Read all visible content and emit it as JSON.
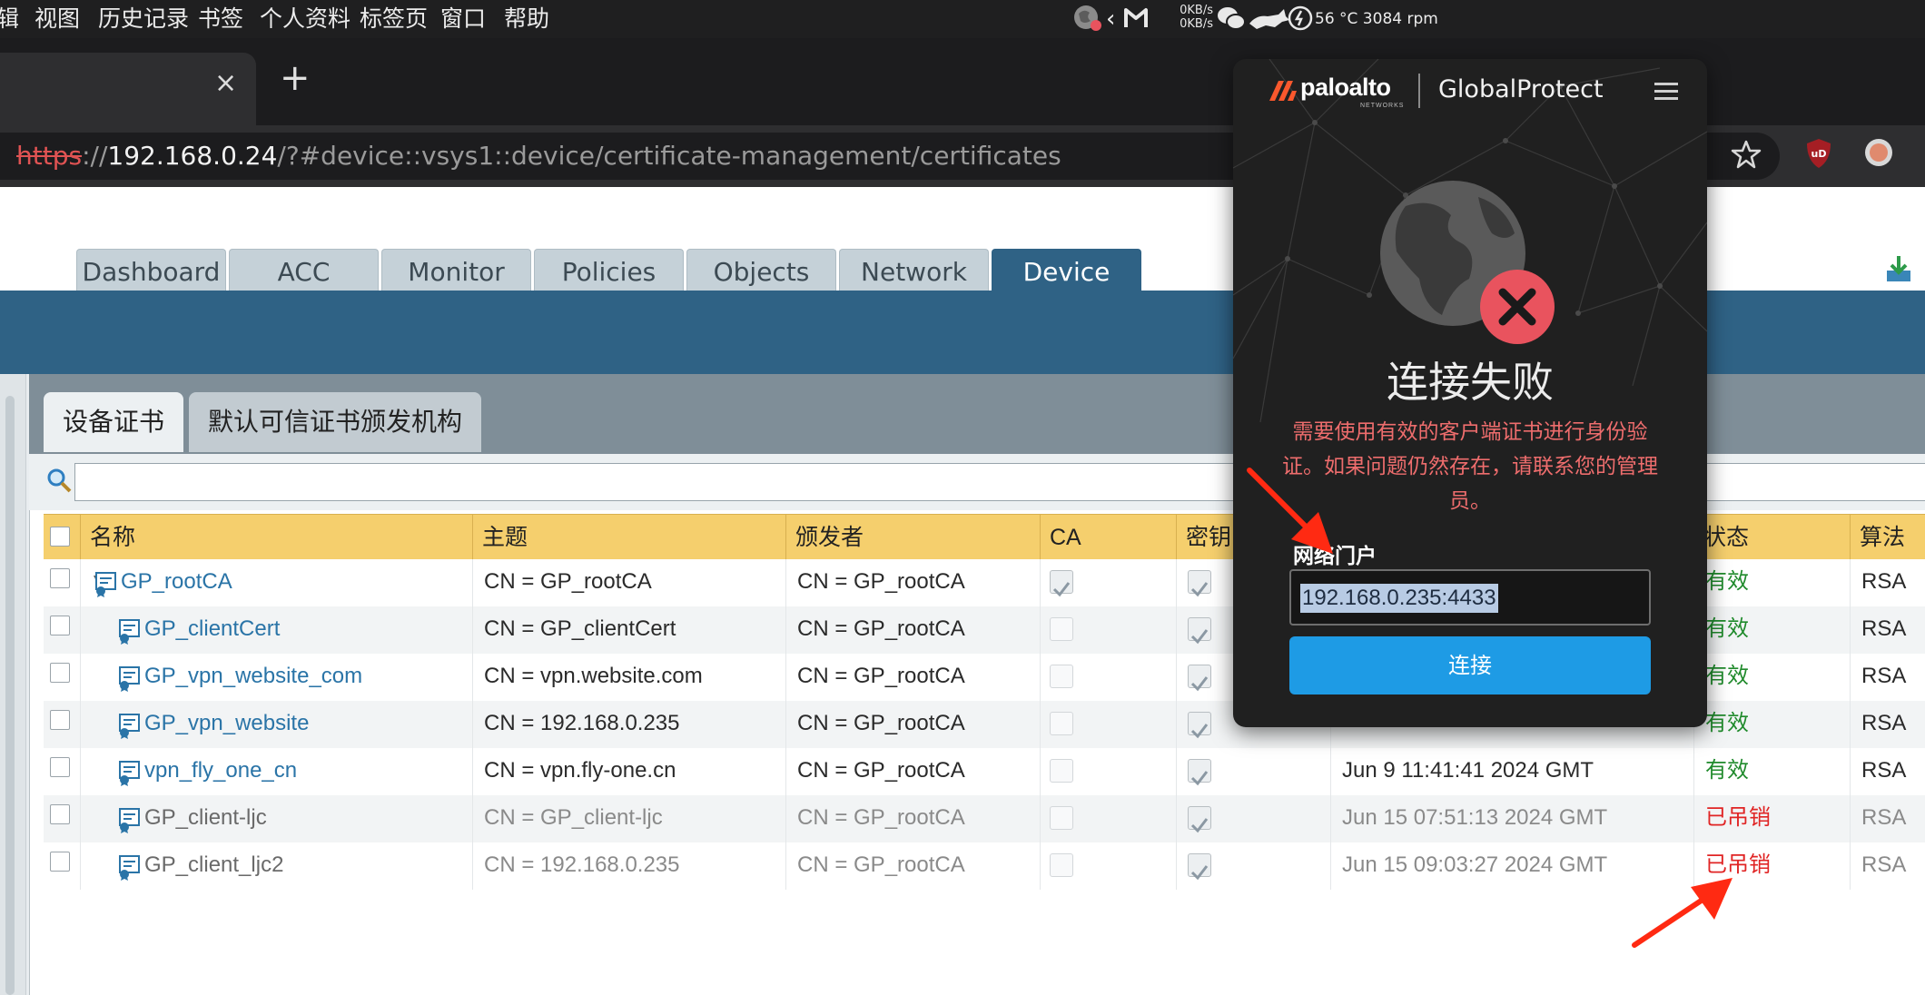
{
  "menubar": {
    "items": [
      "辑",
      "视图",
      "历史记录",
      "书签",
      "个人资料",
      "标签页",
      "窗口",
      "帮助"
    ],
    "net_up": "0KB/s",
    "net_down": "0KB/s",
    "sensors": "56 °C 3084 rpm"
  },
  "browser": {
    "url_scheme": "https",
    "url_sep": "://",
    "url_host": "192.168.0.24",
    "url_path": "/?#device::vsys1::device/certificate-management/certificates",
    "new_tab_label": "+",
    "close_tab_label": "×",
    "extension_badge": "uD"
  },
  "nav": {
    "tabs": [
      "Dashboard",
      "ACC",
      "Monitor",
      "Policies",
      "Objects",
      "Network",
      "Device"
    ],
    "active": "Device"
  },
  "subtabs": [
    "设备证书",
    "默认可信证书颁发机构"
  ],
  "table": {
    "headers": [
      "名称",
      "主题",
      "颁发者",
      "CA",
      "密钥",
      "状态",
      "算法"
    ],
    "rows": [
      {
        "name": "GP_rootCA",
        "subject": "CN = GP_rootCA",
        "issuer": "CN = GP_rootCA",
        "ca": true,
        "key": true,
        "expires": "",
        "status": "有效",
        "algo": "RSA"
      },
      {
        "name": "GP_clientCert",
        "subject": "CN = GP_clientCert",
        "issuer": "CN = GP_rootCA",
        "ca": false,
        "key": true,
        "expires": "",
        "status": "有效",
        "algo": "RSA"
      },
      {
        "name": "GP_vpn_website_com",
        "subject": "CN = vpn.website.com",
        "issuer": "CN = GP_rootCA",
        "ca": false,
        "key": true,
        "expires": "",
        "status": "有效",
        "algo": "RSA"
      },
      {
        "name": "GP_vpn_website",
        "subject": "CN = 192.168.0.235",
        "issuer": "CN = GP_rootCA",
        "ca": false,
        "key": true,
        "expires": "",
        "status": "有效",
        "algo": "RSA"
      },
      {
        "name": "vpn_fly_one_cn",
        "subject": "CN = vpn.fly-one.cn",
        "issuer": "CN = GP_rootCA",
        "ca": false,
        "key": true,
        "expires": "Jun 9 11:41:41 2024 GMT",
        "status": "有效",
        "algo": "RSA"
      },
      {
        "name": "GP_client-ljc",
        "subject": "CN = GP_client-ljc",
        "issuer": "CN = GP_rootCA",
        "ca": false,
        "key": true,
        "expires": "Jun 15 07:51:13 2024 GMT",
        "status": "已吊销",
        "algo": "RSA"
      },
      {
        "name": "GP_client_ljc2",
        "subject": "CN = 192.168.0.235",
        "issuer": "CN = GP_rootCA",
        "ca": false,
        "key": true,
        "expires": "Jun 15 09:03:27 2024 GMT",
        "status": "已吊销",
        "algo": "RSA"
      }
    ]
  },
  "gp": {
    "brand": "paloalto",
    "brand_sub": "NETWORKS",
    "product": "GlobalProtect",
    "fail_title": "连接失败",
    "fail_msg": "需要使用有效的客户端证书进行身份验证。如果问题仍然存在，请联系您的管理员。",
    "portal_label": "网络门户",
    "portal_value": "192.168.0.235:4433",
    "connect_label": "连接"
  },
  "colors": {
    "nav_band": "#2f6285",
    "table_header": "#f5cf6d",
    "status_ok": "#1f8a2b",
    "status_revoked": "#e02424",
    "gp_error": "#e9535e",
    "gp_button": "#1e9be5",
    "annotation_arrow": "#ff2a12"
  }
}
